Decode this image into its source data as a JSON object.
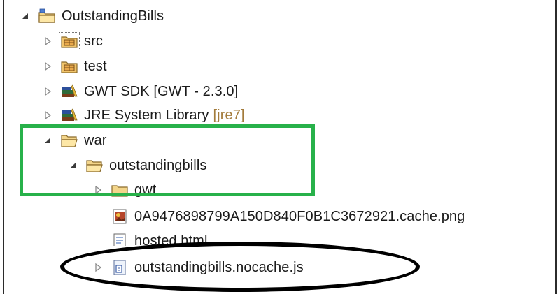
{
  "tree": {
    "project": {
      "label": "OutstandingBills",
      "icon": "project-folder-icon"
    },
    "src": {
      "label": "src",
      "icon": "package-folder-icon"
    },
    "test": {
      "label": "test",
      "icon": "package-folder-icon"
    },
    "gwt_sdk": {
      "label": "GWT SDK [GWT - 2.3.0]",
      "icon": "library-icon"
    },
    "jre": {
      "label": "JRE System Library",
      "decoration": "[jre7]",
      "icon": "library-icon"
    },
    "war": {
      "label": "war",
      "icon": "folder-open-icon"
    },
    "outstandingbills": {
      "label": "outstandingbills",
      "icon": "folder-open-icon"
    },
    "gwt": {
      "label": "gwt",
      "icon": "folder-icon"
    },
    "cache_png": {
      "label": "0A9476898799A150D840F0B1C3672921.cache.png",
      "icon": "image-file-icon"
    },
    "hosted": {
      "label": "hosted.html",
      "icon": "html-file-icon"
    },
    "nocache_js": {
      "label": "outstandingbills.nocache.js",
      "icon": "js-file-icon"
    }
  },
  "annotations": {
    "green_box_color": "#28b14a",
    "ellipse_color": "#000000"
  }
}
